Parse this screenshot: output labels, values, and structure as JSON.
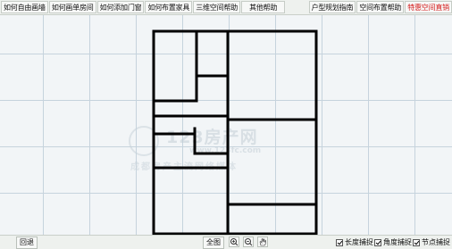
{
  "toolbar": {
    "left": [
      "如何自由画墙",
      "如何画单房间",
      "如何添加门窗",
      "如何布置家具",
      "三维空间帮助",
      "其他帮助"
    ],
    "right": [
      "户型规划指南",
      "空间布置帮助"
    ],
    "special": "特惠空间直销",
    "special_color": "#d41e1e"
  },
  "watermark": {
    "title": "123房产网",
    "url": "www.123fc.com",
    "slogan": "成都房产主流网络媒体"
  },
  "bottom": {
    "back": "回退",
    "fit": "全图",
    "tools": [
      "zoom-in-icon",
      "zoom-out-icon",
      "pan-hand-icon"
    ],
    "checks": [
      {
        "label": "长度捕捉",
        "checked": true
      },
      {
        "label": "角度捕捉",
        "checked": true
      },
      {
        "label": "节点捕捉",
        "checked": true
      }
    ]
  }
}
